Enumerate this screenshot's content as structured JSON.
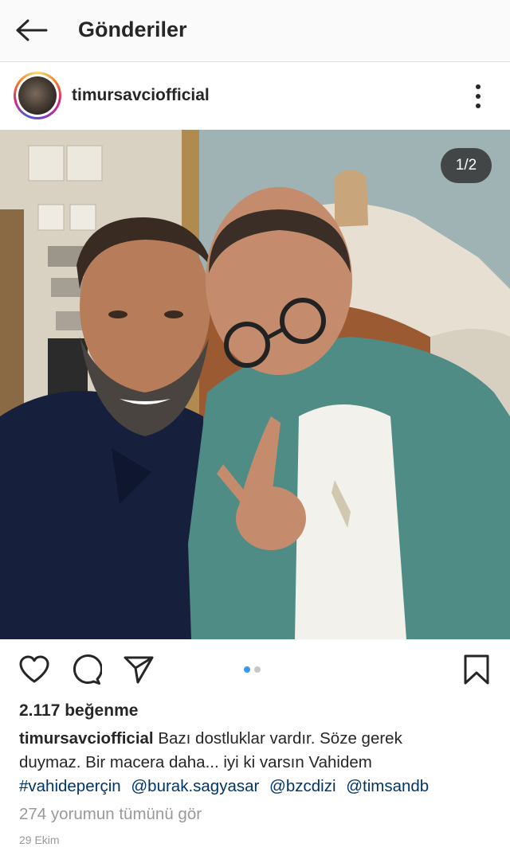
{
  "header": {
    "title": "Gönderiler",
    "back_icon": "arrow-left-icon"
  },
  "post": {
    "username": "timursavciofficial",
    "counter": "1/2",
    "photo_count": 2,
    "current_photo": 1,
    "likes": "2.117 beğenme",
    "caption_user": "timursavciofficial",
    "caption_line1": "Bazı dostluklar vardır. Söze gerek",
    "caption_line2": "duymaz.  Bir macera daha... iyi ki varsın Vahidem",
    "tags": [
      "#vahideperçin",
      "@burak.sagyasar",
      "@bzcdizi",
      "@timsandb"
    ],
    "comments_link": "274 yorumun tümünü gör",
    "date": "29 Ekim"
  },
  "icons": {
    "like": "heart-icon",
    "comment": "comment-icon",
    "share": "send-icon",
    "save": "bookmark-icon",
    "more": "more-vertical-icon"
  },
  "colors": {
    "link": "#003569",
    "muted": "#999999",
    "active_dot": "#3897f0",
    "text": "#262626"
  }
}
